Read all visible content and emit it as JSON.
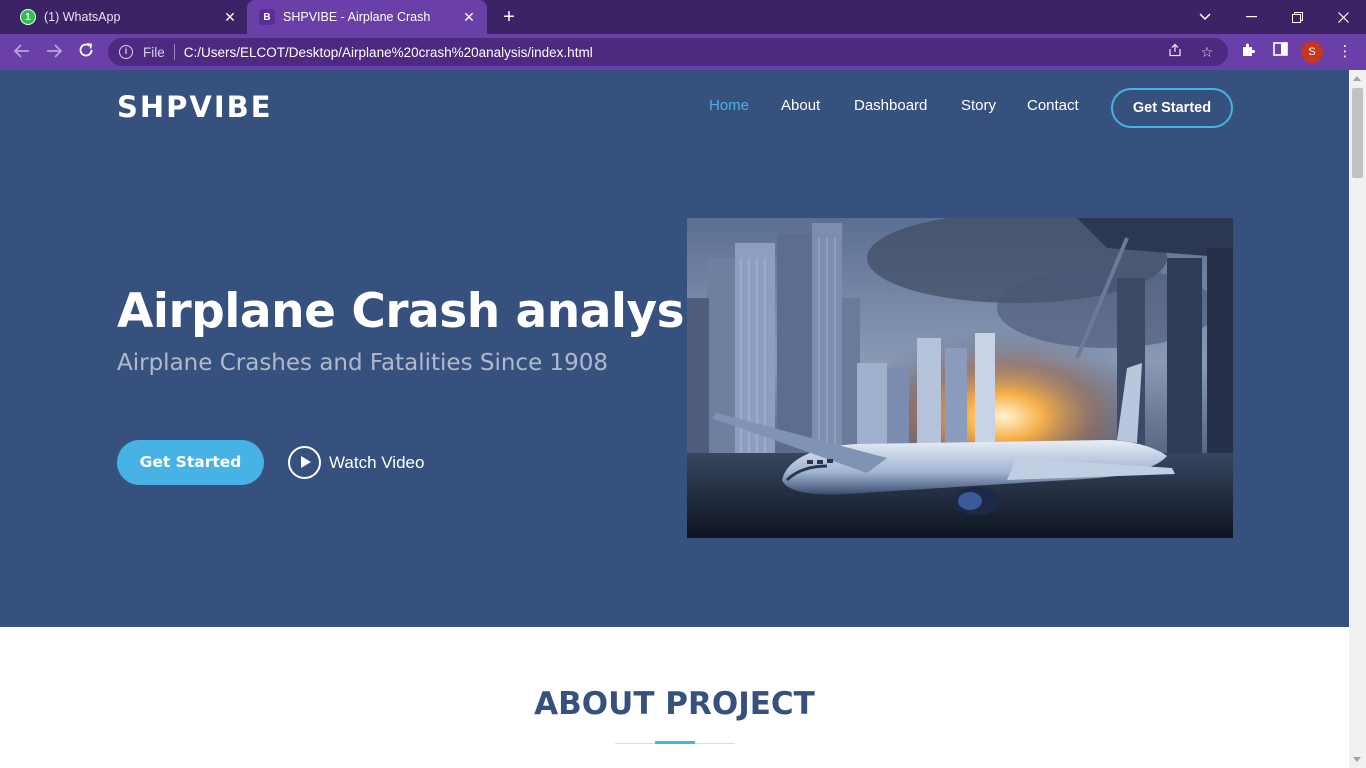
{
  "browser": {
    "tabs": [
      {
        "title": "(1) WhatsApp",
        "icon": "whatsapp-icon",
        "active": false
      },
      {
        "title": "SHPVIBE - Airplane Crash",
        "icon": "bootstrap-icon",
        "active": true
      }
    ],
    "favicon_letters": {
      "whatsapp": "1",
      "shpvibe": "B"
    },
    "address": {
      "scheme_label": "File",
      "url": "C:/Users/ELCOT/Desktop/Airplane%20crash%20analysis/index.html"
    },
    "profile_initial": "S",
    "colors": {
      "tabbar": "#3b2366",
      "toolbar": "#6b3fa8"
    }
  },
  "site": {
    "logo": "SHPVIBE",
    "nav": [
      {
        "label": "Home",
        "active": true
      },
      {
        "label": "About",
        "active": false
      },
      {
        "label": "Dashboard",
        "active": false
      },
      {
        "label": "Story",
        "active": false
      },
      {
        "label": "Contact",
        "active": false
      }
    ],
    "nav_cta": "Get Started",
    "hero": {
      "title": "Airplane Crash analysis",
      "subtitle": "Airplane Crashes and Fatalities Since 1908",
      "cta": "Get Started",
      "video_label": "Watch Video"
    },
    "about": {
      "title": "ABOUT PROJECT"
    },
    "colors": {
      "hero_bg": "#37517e",
      "accent": "#47b2e4"
    }
  }
}
